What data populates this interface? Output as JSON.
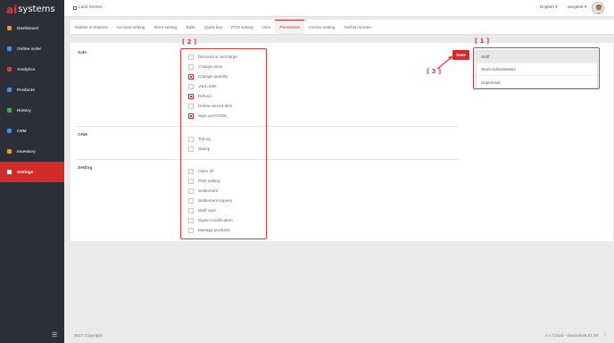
{
  "app": {
    "logo_mark": "ai",
    "logo_text": "systems"
  },
  "sidebar": {
    "items": [
      {
        "label": "Dashboard",
        "icon": "dashboard-icon",
        "color": "#e0a020"
      },
      {
        "label": "Online order",
        "icon": "cart-icon",
        "color": "#4a90d9"
      },
      {
        "label": "Analytics",
        "icon": "analytics-icon",
        "color": "#e23a3a"
      },
      {
        "label": "Products",
        "icon": "tag-icon",
        "color": "#4a90d9"
      },
      {
        "label": "History",
        "icon": "history-icon",
        "color": "#3bb050"
      },
      {
        "label": "CRM",
        "icon": "crm-icon",
        "color": "#4a90d9"
      },
      {
        "label": "Inventory",
        "icon": "inventory-icon",
        "color": "#e0a020"
      },
      {
        "label": "Settings",
        "icon": "settings-icon",
        "color": "#e0a020"
      }
    ],
    "active_index": 7
  },
  "topbar": {
    "lock_label": "Lock Screen",
    "language": "English ▾",
    "user": "wingtest ▾"
  },
  "tabs": [
    {
      "label": "Outlets & Stations"
    },
    {
      "label": "Account setting"
    },
    {
      "label": "Store setting"
    },
    {
      "label": "Table"
    },
    {
      "label": "Quick key"
    },
    {
      "label": "POS setting"
    },
    {
      "label": "User"
    },
    {
      "label": "Permission",
      "active": true
    },
    {
      "label": "Invoice setting"
    },
    {
      "label": "Kitchen screen"
    }
  ],
  "permissions": {
    "sections": [
      {
        "label": "Sale",
        "items": [
          {
            "label": "Discount & surcharge",
            "checked": false
          },
          {
            "label": "Change price",
            "checked": false
          },
          {
            "label": "Change quantity",
            "checked": true
          },
          {
            "label": "Void order",
            "checked": false
          },
          {
            "label": "Refund",
            "checked": true
          },
          {
            "label": "Delete served item",
            "checked": false
          },
          {
            "label": "Sign out KIOSK",
            "checked": true
          }
        ]
      },
      {
        "label": "CRM",
        "items": [
          {
            "label": "Top-up",
            "checked": false
          },
          {
            "label": "Stamp",
            "checked": false
          }
        ]
      },
      {
        "label": "Setting",
        "items": [
          {
            "label": "Open till",
            "checked": false
          },
          {
            "label": "POS setting",
            "checked": false
          },
          {
            "label": "Settlement",
            "checked": false
          },
          {
            "label": "Settlement inquery",
            "checked": false
          },
          {
            "label": "Staff card",
            "checked": false
          },
          {
            "label": "Signin modification",
            "checked": false
          },
          {
            "label": "Manage products",
            "checked": false
          }
        ]
      }
    ],
    "save_label": "Save"
  },
  "roles": {
    "items": [
      {
        "label": "Staff",
        "selected": true
      },
      {
        "label": "Store Administrator",
        "selected": false
      },
      {
        "label": "Supervisor",
        "selected": false
      }
    ]
  },
  "annotations": {
    "label_1": "[ 1 ]",
    "label_2": "[ 2 ]",
    "label_3": "[ 3 ]",
    "color": "#e23a3a"
  },
  "footer": {
    "copyright": "2017 Copyright.",
    "version": "A.I. Cloud - vbazooka5.21.80",
    "menu_glyph": "⋮"
  }
}
